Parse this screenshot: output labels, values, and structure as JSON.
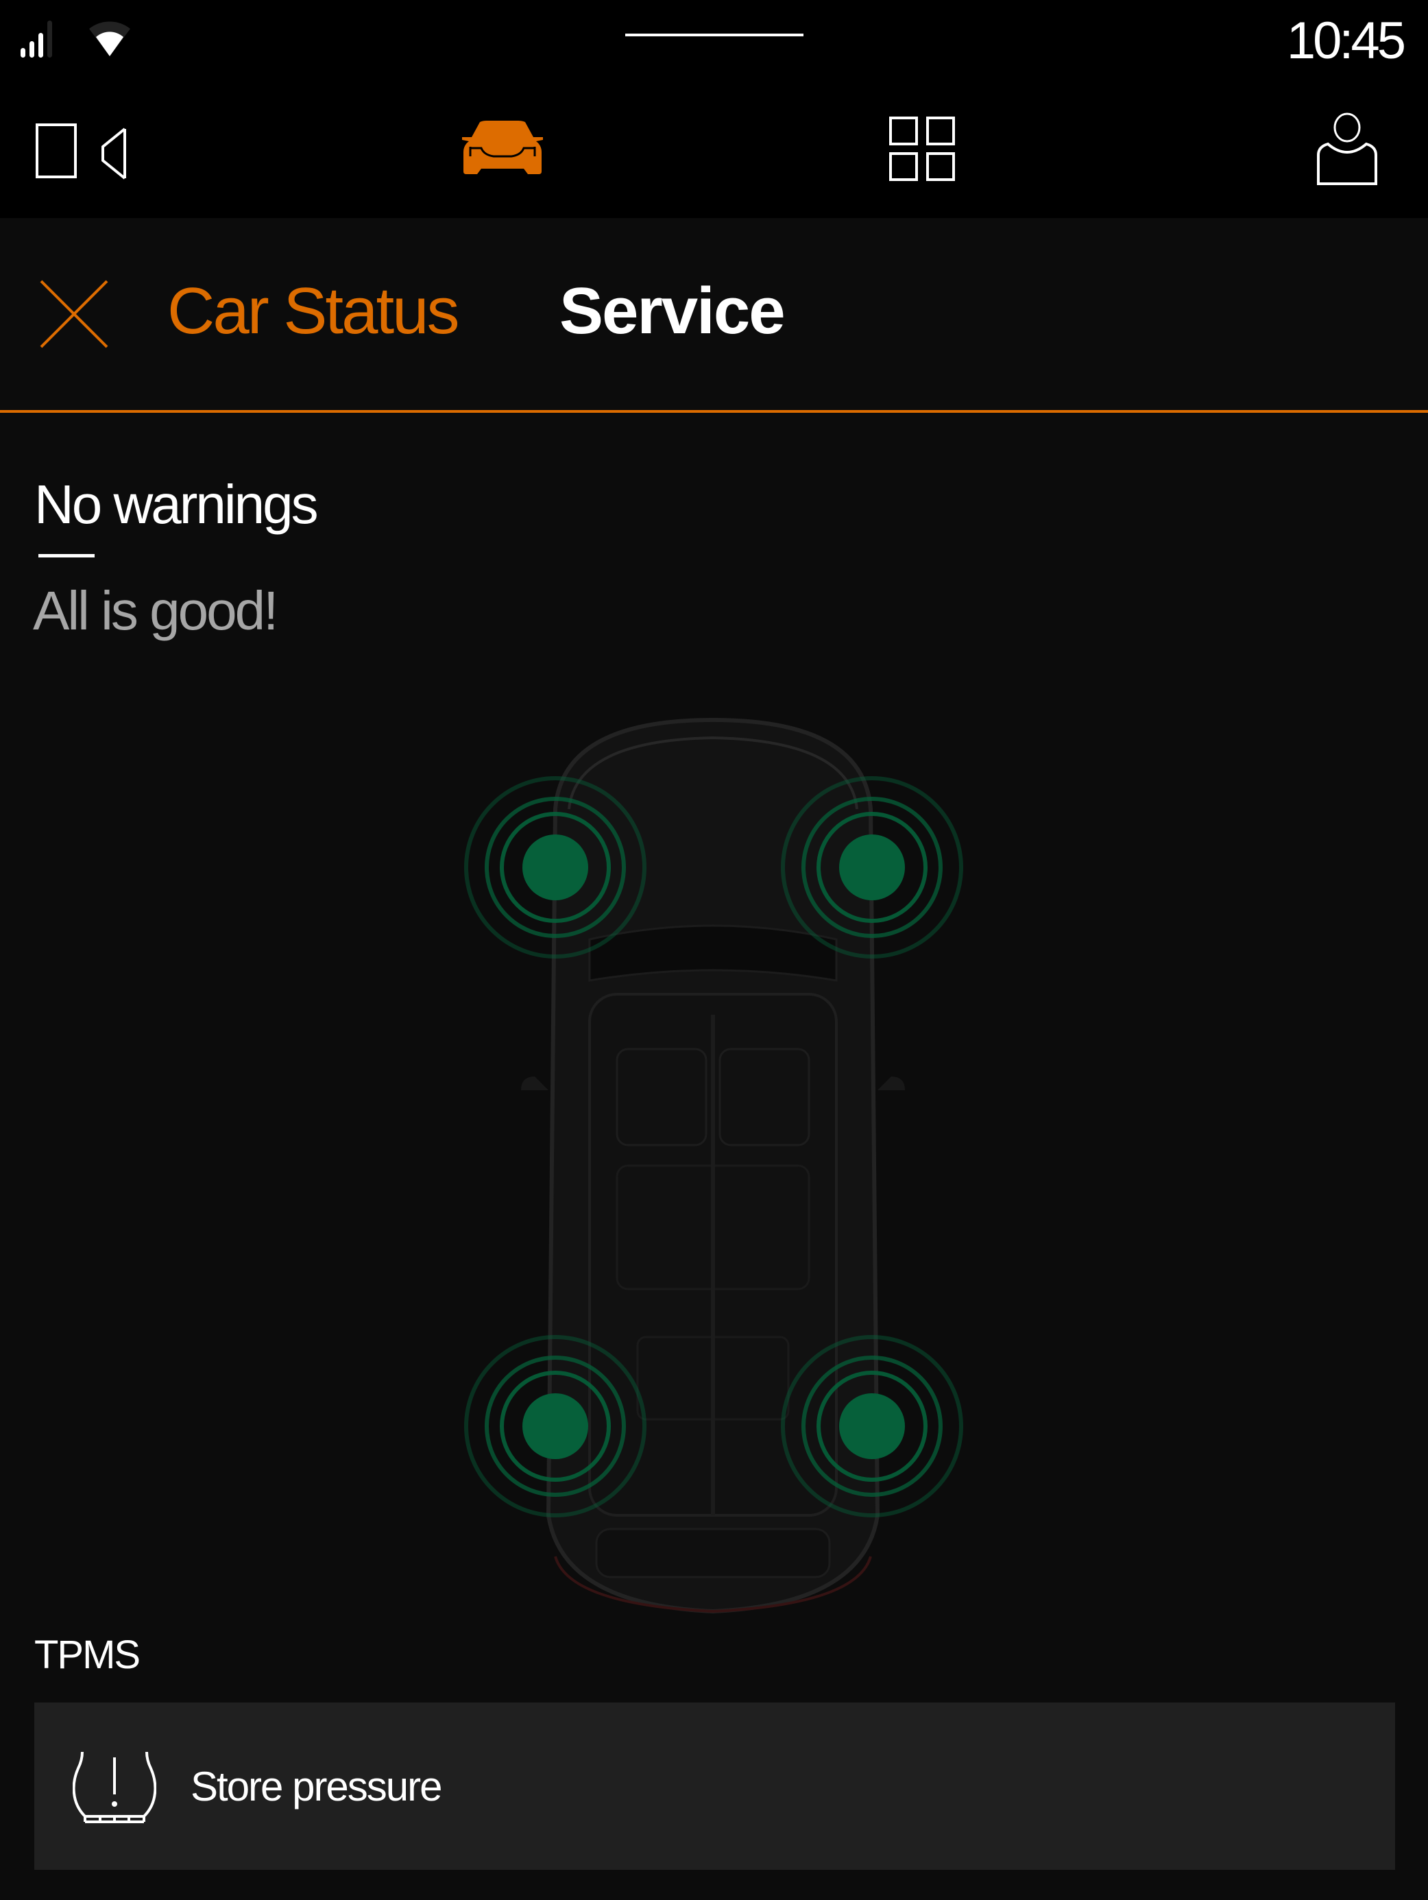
{
  "status_bar": {
    "time": "10:45",
    "signal_icon": "signal-strength-icon",
    "signal_bars_active": 3,
    "signal_bars_total": 4,
    "wifi_icon": "wifi-icon"
  },
  "nav": {
    "items": [
      {
        "id": "camera",
        "icon": "video-camera-icon",
        "active": false
      },
      {
        "id": "car",
        "icon": "car-front-icon",
        "active": true
      },
      {
        "id": "apps",
        "icon": "app-grid-icon",
        "active": false
      },
      {
        "id": "profile",
        "icon": "user-profile-icon",
        "active": false
      }
    ]
  },
  "header": {
    "close_icon": "close-icon",
    "tabs": [
      {
        "label": "Car Status",
        "active": true
      },
      {
        "label": "Service",
        "active": false
      }
    ]
  },
  "status": {
    "title": "No warnings",
    "subtitle": "All is good!"
  },
  "tires": [
    {
      "position": "front-left",
      "status": "ok"
    },
    {
      "position": "front-right",
      "status": "ok"
    },
    {
      "position": "rear-left",
      "status": "ok"
    },
    {
      "position": "rear-right",
      "status": "ok"
    }
  ],
  "tpms": {
    "section_label": "TPMS",
    "action_label": "Store pressure",
    "action_icon": "tire-pressure-warning-icon"
  },
  "colors": {
    "accent": "#dd6c00",
    "ok_green": "#06603a",
    "background": "#0c0c0c",
    "card": "#202020",
    "muted_text": "#a6a6a6"
  }
}
